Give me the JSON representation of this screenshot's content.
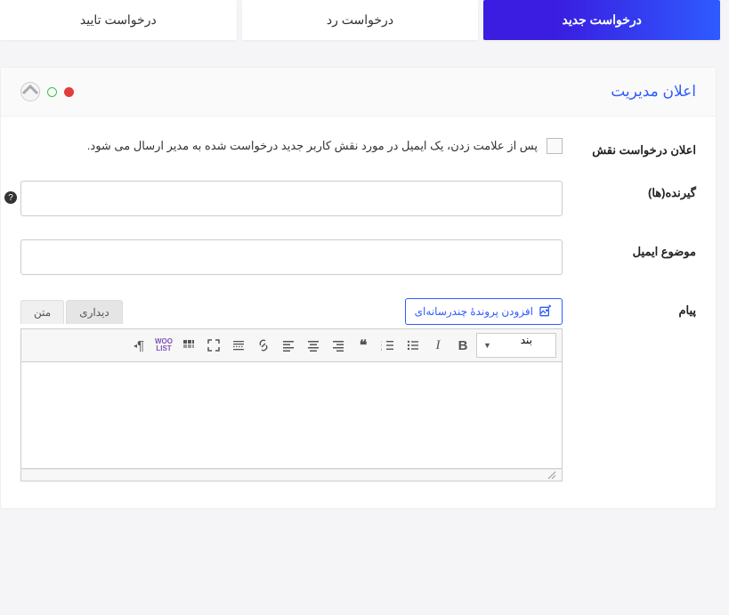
{
  "tabs": {
    "new": "درخواست جدید",
    "reject": "درخواست رد",
    "approve": "درخواست تایید"
  },
  "panel": {
    "title": "اعلان مدیریت"
  },
  "form": {
    "role_notify_label": "اعلان درخواست نقش",
    "role_notify_desc": "پس از علامت زدن، یک ایمیل در مورد نقش کاربر جدید درخواست شده به مدیر ارسال می شود.",
    "recipients_label": "گیرنده(ها)",
    "subject_label": "موضوع ایمیل",
    "message_label": "پیام"
  },
  "editor": {
    "add_media": "افزودن پروندهٔ چندرسانه‌ای",
    "tab_visual": "دیداری",
    "tab_text": "متن",
    "format_select": "بند",
    "help_tooltip": "?"
  }
}
